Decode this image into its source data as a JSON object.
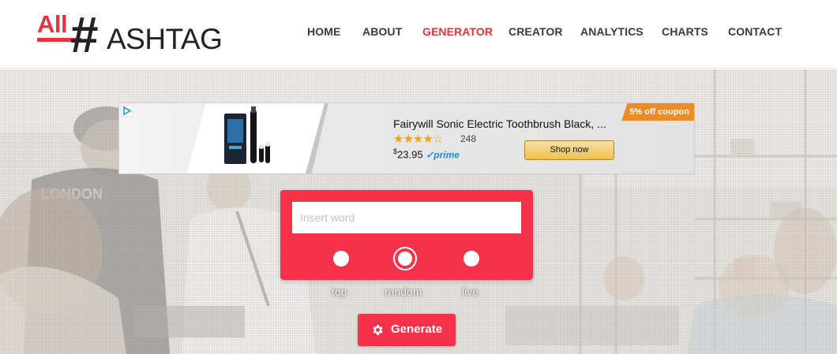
{
  "logo": {
    "all": "All",
    "hash": "#",
    "rest": "ASHTAG",
    "accent_color": "#e8333f"
  },
  "nav": {
    "items": [
      {
        "label": "HOME",
        "active": false
      },
      {
        "label": "ABOUT",
        "active": false
      },
      {
        "label": "GENERATOR",
        "active": true
      },
      {
        "label": "CREATOR",
        "active": false
      },
      {
        "label": "ANALYTICS",
        "active": false
      },
      {
        "label": "CHARTS",
        "active": false
      },
      {
        "label": "CONTACT",
        "active": false
      }
    ]
  },
  "ad": {
    "title": "Fairywill Sonic Electric Toothbrush Black, ...",
    "stars": "★★★★☆",
    "rating_count": "248",
    "price_symbol": "$",
    "price": "23.95",
    "prime_label": "✓prime",
    "shop_button": "Shop now",
    "coupon": "5% off coupon",
    "ad_choices_icon": "adchoices-icon"
  },
  "generator": {
    "input_placeholder": "Insert word",
    "input_value": "",
    "modes": [
      {
        "label": "top",
        "selected": false
      },
      {
        "label": "random",
        "selected": true
      },
      {
        "label": "live",
        "selected": false
      }
    ],
    "generate_label": "Generate",
    "generate_icon": "gear-icon",
    "accent_color": "#f5324a"
  }
}
